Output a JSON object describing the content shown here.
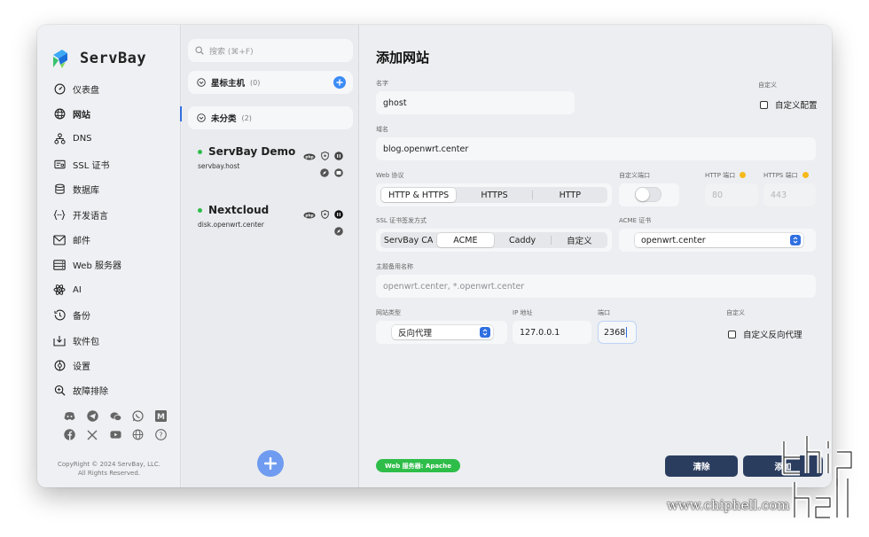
{
  "app": {
    "name": "ServBay",
    "brand_color": "#2f6fe0"
  },
  "sidebar": {
    "items": [
      {
        "label": "仪表盘",
        "icon": "dashboard-icon"
      },
      {
        "label": "网站",
        "icon": "globe-icon",
        "active": true
      },
      {
        "label": "DNS",
        "icon": "dns-icon"
      },
      {
        "label": "SSL 证书",
        "icon": "certificate-icon"
      },
      {
        "label": "数据库",
        "icon": "database-icon"
      },
      {
        "label": "开发语言",
        "icon": "code-icon"
      },
      {
        "label": "邮件",
        "icon": "mail-icon"
      },
      {
        "label": "Web 服务器",
        "icon": "server-icon"
      },
      {
        "label": "AI",
        "icon": "atom-icon"
      },
      {
        "label": "备份",
        "icon": "backup-icon"
      },
      {
        "label": "软件包",
        "icon": "package-icon"
      },
      {
        "label": "设置",
        "icon": "gear-icon"
      },
      {
        "label": "故障排除",
        "icon": "troubleshoot-icon"
      }
    ],
    "socials_row1": [
      "discord-icon",
      "telegram-icon",
      "wechat-icon",
      "whatsapp-icon",
      "medium-icon"
    ],
    "socials_row2": [
      "facebook-icon",
      "x-icon",
      "youtube-icon",
      "globe-icon",
      "help-icon"
    ],
    "copyright_line1": "CopyRight © 2024 ServBay, LLC.",
    "copyright_line2": "All Rights Reserved."
  },
  "list": {
    "search_placeholder": "搜索 (⌘+F)",
    "groups": [
      {
        "name": "星标主机",
        "count": "(0)"
      },
      {
        "name": "未分类",
        "count": "(2)"
      }
    ],
    "sites": [
      {
        "name": "ServBay Demo",
        "domain": "servbay.host",
        "status_color": "#2fbd4a"
      },
      {
        "name": "Nextcloud",
        "domain": "disk.openwrt.center",
        "status_color": "#2fbd4a"
      }
    ]
  },
  "form": {
    "title": "添加网站",
    "name_label": "名字",
    "name_value": "ghost",
    "custom_label": "自定义",
    "custom_config_label": "自定义配置",
    "domain_label": "域名",
    "domain_value": "blog.openwrt.center",
    "protocol_label": "Web 协议",
    "protocol_options": [
      "HTTP & HTTPS",
      "HTTPS",
      "HTTP"
    ],
    "protocol_selected": "HTTP & HTTPS",
    "custom_port_label": "自定义端口",
    "custom_port_enabled": false,
    "http_port_label": "HTTP 端口",
    "http_port_value": "80",
    "https_port_label": "HTTPS 端口",
    "https_port_value": "443",
    "ssl_label": "SSL 证书签发方式",
    "ssl_options": [
      "ServBay CA",
      "ACME",
      "Caddy",
      "自定义"
    ],
    "ssl_selected": "ACME",
    "acme_label": "ACME 证书",
    "acme_value": "openwrt.center",
    "alias_label": "主题备用名称",
    "alias_placeholder": "openwrt.center, *.openwrt.center",
    "type_label": "网站类型",
    "type_value": "反向代理",
    "ip_label": "IP 地址",
    "ip_value": "127.0.0.1",
    "port_label": "端口",
    "port_value": "2368",
    "custom_label2": "自定义",
    "custom_proxy_label": "自定义反向代理",
    "server_badge": "Web 服务器: Apache",
    "clear_button": "清除",
    "add_button": "添加"
  },
  "watermark": {
    "text": "www.chiphell.com"
  }
}
